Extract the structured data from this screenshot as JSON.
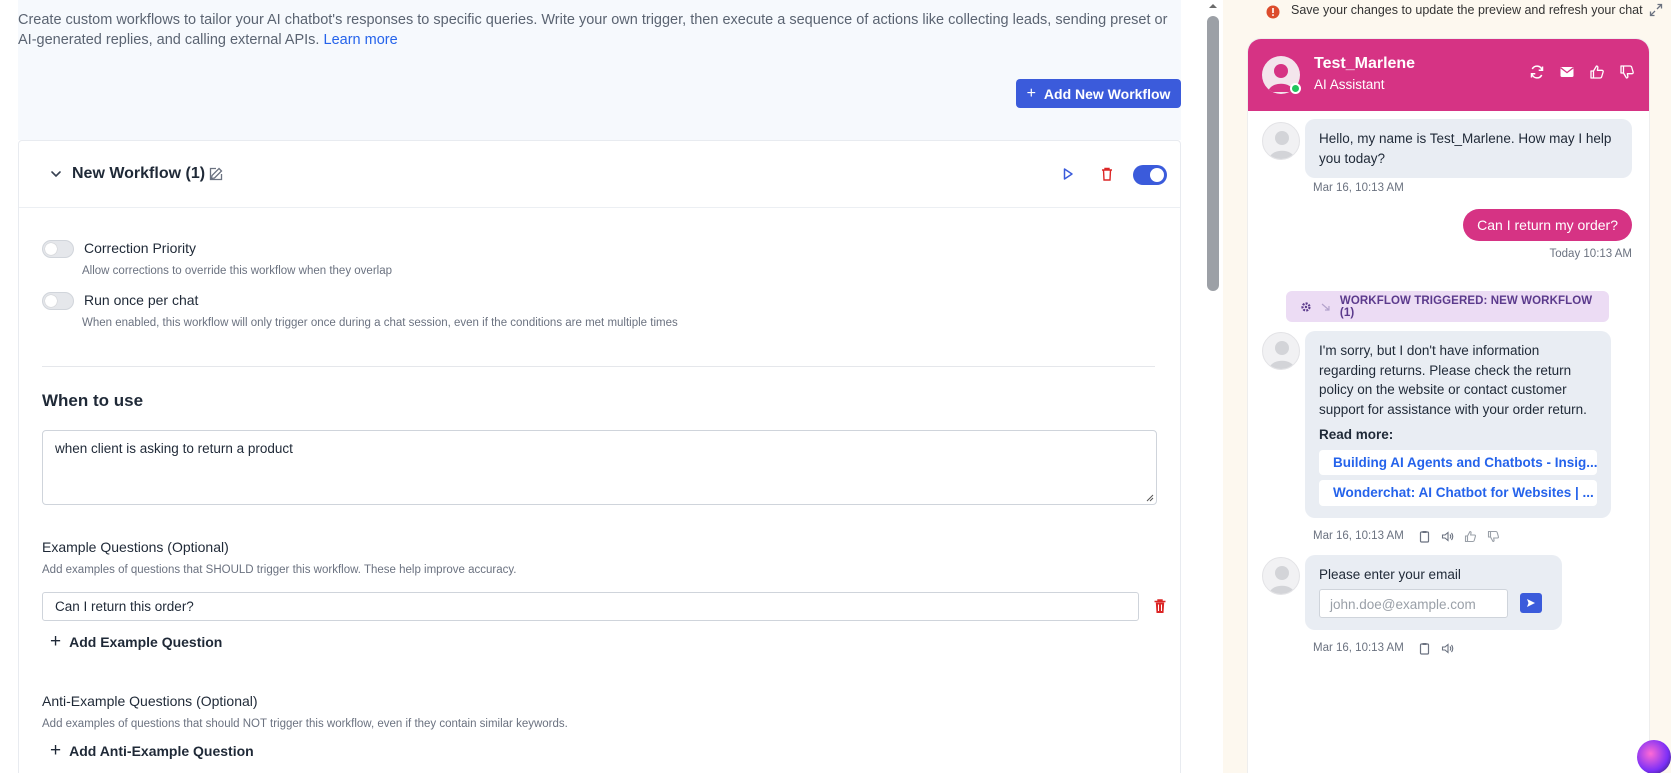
{
  "intro": {
    "text": "Create custom workflows to tailor your AI chatbot's responses to specific queries. Write your own trigger, then execute a sequence of actions like collecting leads, sending preset or AI-generated replies, and calling external APIs.",
    "learn_more": "Learn more"
  },
  "toolbar": {
    "add_workflow_label": "Add New Workflow"
  },
  "workflow": {
    "title": "New Workflow (1)",
    "enabled": true,
    "correction_priority": {
      "label": "Correction Priority",
      "desc": "Allow corrections to override this workflow when they overlap",
      "enabled": false
    },
    "run_once": {
      "label": "Run once per chat",
      "desc": "When enabled, this workflow will only trigger once during a chat session, even if the conditions are met multiple times",
      "enabled": false
    },
    "when_to_use": {
      "title": "When to use",
      "value": "when client is asking to return a product"
    },
    "examples": {
      "label": "Example Questions (Optional)",
      "desc": "Add examples of questions that SHOULD trigger this workflow. These help improve accuracy.",
      "items": [
        "Can I return this order?"
      ],
      "add_label": "Add Example Question"
    },
    "anti_examples": {
      "label": "Anti-Example Questions (Optional)",
      "desc": "Add examples of questions that should NOT trigger this workflow, even if they contain similar keywords.",
      "add_label": "Add Anti-Example Question"
    }
  },
  "preview": {
    "warning": "Save your changes to update the preview and refresh your chat",
    "bot_name": "Test_Marlene",
    "bot_subtitle": "AI Assistant",
    "accent": "#d63384",
    "messages": {
      "greeting": "Hello, my name is Test_Marlene. How may I help you today?",
      "greeting_ts": "Mar 16, 10:13 AM",
      "user_msg": "Can I return my order?",
      "user_ts": "Today 10:13 AM",
      "workflow_badge": "WORKFLOW TRIGGERED: NEW WORKFLOW (1)",
      "reply": "I'm sorry, but I don't have information regarding returns. Please check the return policy on the website or contact customer support for assistance with your order return.",
      "read_more": "Read more:",
      "links": [
        "Building AI Agents and Chatbots - Insig...",
        "Wonderchat: AI Chatbot for Websites | ..."
      ],
      "reply_ts": "Mar 16, 10:13 AM",
      "email_prompt": "Please enter your email",
      "email_placeholder": "john.doe@example.com",
      "email_ts": "Mar 16, 10:13 AM"
    }
  }
}
